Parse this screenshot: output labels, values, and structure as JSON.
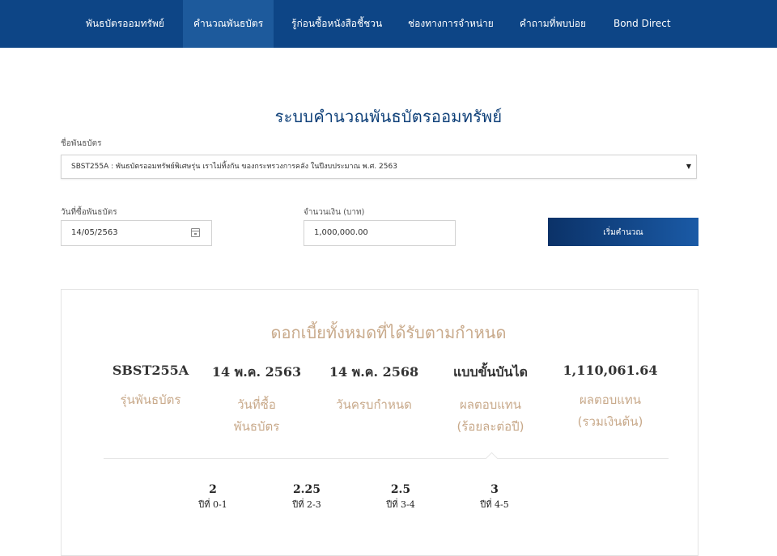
{
  "nav": {
    "items": [
      {
        "label": "พันธบัตรออมทรัพย์"
      },
      {
        "label": "คำนวณพันธบัตร"
      },
      {
        "label": "รู้ก่อนซื้อหนังสือชี้ชวน"
      },
      {
        "label": "ช่องทางการจำหน่าย"
      },
      {
        "label": "คำถามที่พบบ่อย"
      },
      {
        "label": "Bond Direct"
      }
    ],
    "active_index": 1
  },
  "page": {
    "title": "ระบบคำนวณพันธบัตรออมทรัพย์"
  },
  "form": {
    "bond_label": "ชื่อพันธบัตร",
    "bond_selected": "SBST255A : พันธบัตรออมทรัพย์พิเศษรุ่น เราไม่ทิ้งกัน ของกระทรวงการคลัง ในปีงบประมาณ พ.ศ. 2563",
    "date_label": "วันที่ซื้อพันธบัตร",
    "date_value": "14/05/2563",
    "amount_label": "จำนวนเงิน (บาท)",
    "amount_value": "1,000,000.00",
    "calculate_label": "เริ่มคำนวณ"
  },
  "result": {
    "heading": "ดอกเบี้ยทั้งหมดที่ได้รับตามกำหนด",
    "columns": [
      {
        "value": "SBST255A",
        "caption": "รุ่นพันธบัตร"
      },
      {
        "value": "14 พ.ค. 2563",
        "caption": "วันที่ซื้อ\nพันธบัตร"
      },
      {
        "value": "14 พ.ค. 2568",
        "caption": "วันครบกำหนด"
      },
      {
        "value": "แบบขั้นบันได",
        "caption": "ผลตอบแทน\n(ร้อยละต่อปี)"
      },
      {
        "value": "1,110,061.64",
        "caption": "ผลตอบแทน\n(รวมเงินต้น)"
      }
    ],
    "rates": [
      {
        "rate": "2",
        "year": "ปีที่ 0-1"
      },
      {
        "rate": "2.25",
        "year": "ปีที่ 2-3"
      },
      {
        "rate": "2.5",
        "year": "ปีที่ 3-4"
      },
      {
        "rate": "3",
        "year": "ปีที่ 4-5"
      }
    ]
  },
  "colors": {
    "nav_bg": "#0d4586",
    "nav_active": "#1d5a9c",
    "accent_gold": "#c8a98a",
    "title_blue": "#0d3f78"
  }
}
